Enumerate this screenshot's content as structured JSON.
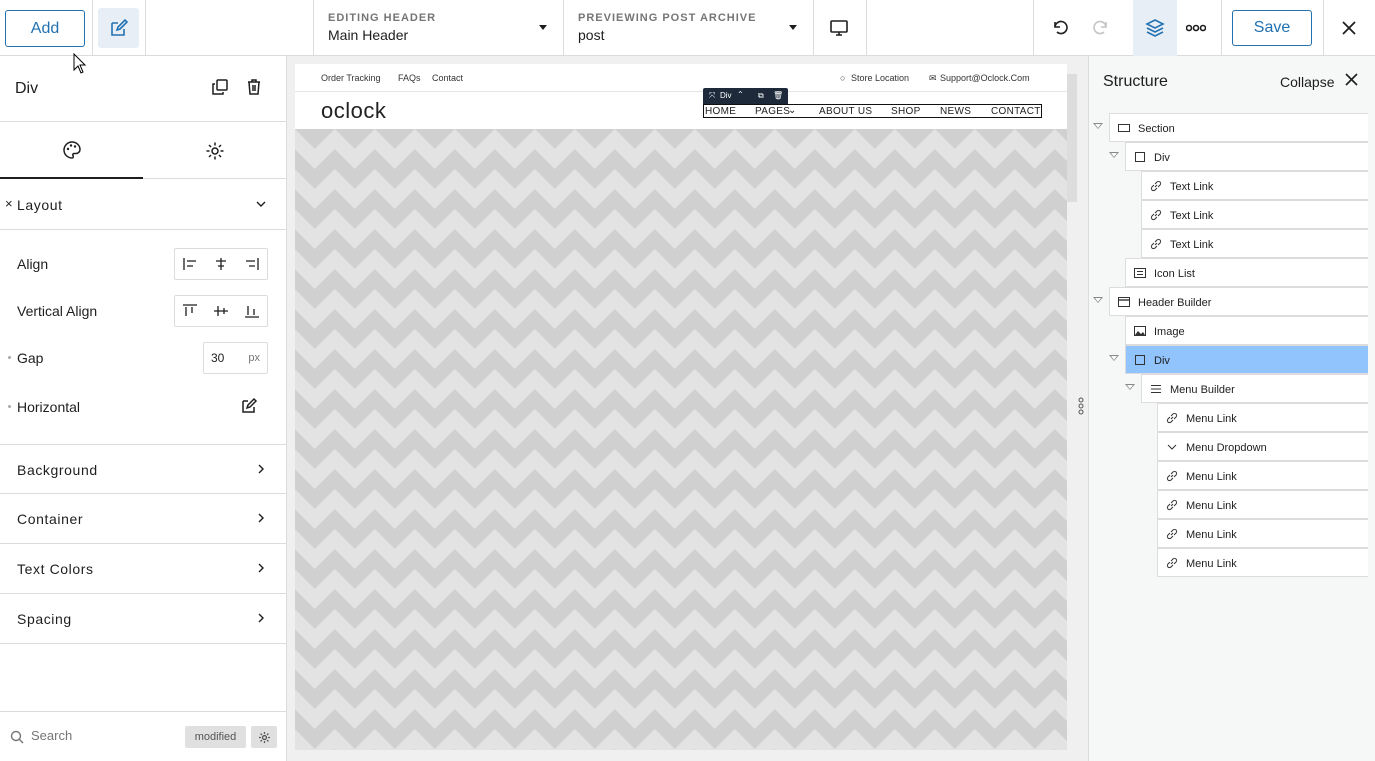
{
  "toolbar": {
    "add_label": "Add",
    "editing_label": "EDITING HEADER",
    "editing_value": "Main Header",
    "preview_label": "PREVIEWING POST ARCHIVE",
    "preview_value": "post",
    "save_label": "Save"
  },
  "left_panel": {
    "title": "Div",
    "sections": {
      "layout": "Layout",
      "background": "Background",
      "container": "Container",
      "text_colors": "Text Colors",
      "spacing": "Spacing"
    },
    "fields": {
      "align": "Align",
      "vertical_align": "Vertical Align",
      "gap": "Gap",
      "gap_value": "30",
      "gap_unit": "px",
      "horizontal": "Horizontal"
    },
    "footer": {
      "search_placeholder": "Search",
      "badge": "modified"
    }
  },
  "preview": {
    "topbar_links": [
      "Order Tracking",
      "FAQs",
      "Contact"
    ],
    "store_location": "Store Location",
    "support_email": "Support@Oclock.Com",
    "logo": "oclock",
    "menu": [
      "HOME",
      "PAGES",
      "ABOUT US",
      "SHOP",
      "NEWS",
      "CONTACT"
    ],
    "div_tag": "Div"
  },
  "structure": {
    "title": "Structure",
    "collapse_label": "Collapse",
    "items": [
      {
        "label": "Section",
        "icon": "section-icon"
      },
      {
        "label": "Div",
        "icon": "div-icon"
      },
      {
        "label": "Text Link",
        "icon": "link-icon"
      },
      {
        "label": "Text Link",
        "icon": "link-icon"
      },
      {
        "label": "Text Link",
        "icon": "link-icon"
      },
      {
        "label": "Icon List",
        "icon": "list-icon"
      },
      {
        "label": "Header Builder",
        "icon": "header-icon"
      },
      {
        "label": "Image",
        "icon": "image-icon"
      },
      {
        "label": "Div",
        "icon": "div-icon"
      },
      {
        "label": "Menu Builder",
        "icon": "menu-icon"
      },
      {
        "label": "Menu Link",
        "icon": "link-icon"
      },
      {
        "label": "Menu Dropdown",
        "icon": "dropdown-icon"
      },
      {
        "label": "Menu Link",
        "icon": "link-icon"
      },
      {
        "label": "Menu Link",
        "icon": "link-icon"
      },
      {
        "label": "Menu Link",
        "icon": "link-icon"
      },
      {
        "label": "Menu Link",
        "icon": "link-icon"
      }
    ]
  },
  "colors": {
    "accent": "#2271b1",
    "selected_row": "#91c3fd"
  }
}
